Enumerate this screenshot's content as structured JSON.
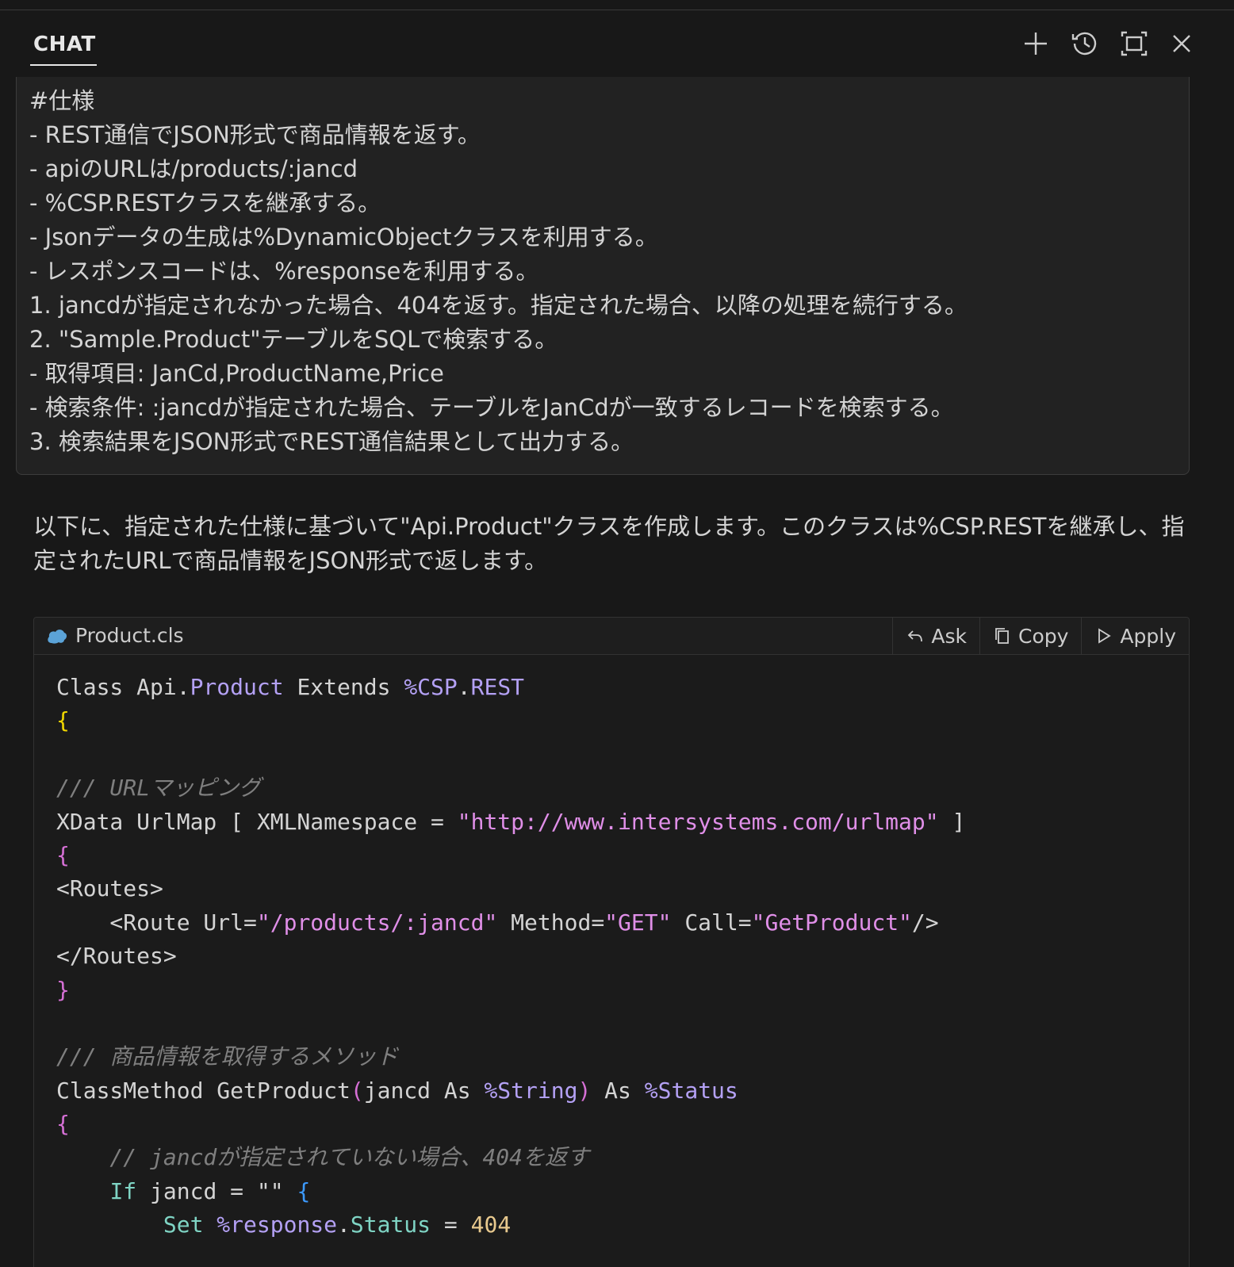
{
  "header": {
    "tab_label": "CHAT"
  },
  "user_message": {
    "lines": [
      "#仕様",
      "- REST通信でJSON形式で商品情報を返す。",
      "- apiのURLは/products/:jancd",
      "- %CSP.RESTクラスを継承する。",
      "- Jsonデータの生成は%DynamicObjectクラスを利用する。",
      "- レスポンスコードは、%responseを利用する。",
      "1. jancdが指定されなかった場合、404を返す。指定された場合、以降の処理を続行する。",
      "2. \"Sample.Product\"テーブルをSQLで検索する。",
      "- 取得項目: JanCd,ProductName,Price",
      "- 検索条件: :jancdが指定された場合、テーブルをJanCdが一致するレコードを検索する。",
      "3. 検索結果をJSON形式でREST通信結果として出力する。"
    ]
  },
  "assistant": {
    "intro": "以下に、指定された仕様に基づいて\"Api.Product\"クラスを作成します。このクラスは%CSP.RESTを継承し、指定されたURLで商品情報をJSON形式で返します。"
  },
  "code_block": {
    "file_name": "Product.cls",
    "actions": {
      "ask": "Ask",
      "copy": "Copy",
      "apply": "Apply"
    },
    "code": {
      "l1_a": "Class Api.",
      "l1_b": "Product",
      "l1_c": " Extends ",
      "l1_d": "%CSP",
      "l1_e": ".",
      "l1_f": "REST",
      "brace_open": "{",
      "brace_close": "}",
      "cmt_urlmap": "/// URLマッピング",
      "xdata_a": "XData UrlMap [ XMLNamespace = ",
      "xdata_b": "\"http://www.intersystems.com/urlmap\"",
      "xdata_c": " ]",
      "routes_open": "<Routes>",
      "route_a": "    <Route Url=",
      "route_b": "\"/products/:jancd\"",
      "route_c": " Method=",
      "route_d": "\"GET\"",
      "route_e": " Call=",
      "route_f": "\"GetProduct\"",
      "route_g": "/>",
      "routes_close": "</Routes>",
      "cmt_method": "/// 商品情報を取得するメソッド",
      "cm_a": "ClassMethod GetProduct",
      "cm_b": "(",
      "cm_c": "jancd As ",
      "cm_d": "%String",
      "cm_e": ")",
      "cm_f": " As ",
      "cm_g": "%Status",
      "cmt_if": "    // jancdが指定されていない場合、404を返す",
      "if_a": "    ",
      "if_b": "If",
      "if_c": " jancd = \"\" ",
      "if_d": "{",
      "set_a": "        ",
      "set_b": "Set",
      "set_c": " ",
      "set_d": "%response",
      "set_e": ".",
      "set_f": "Status",
      "set_g": " = ",
      "set_h": "404"
    }
  },
  "colors": {
    "background": "#181818",
    "class_name": "#b4a1f5",
    "string": "#e08fe8",
    "comment": "#7f7f7f",
    "number": "#e8c98e"
  }
}
